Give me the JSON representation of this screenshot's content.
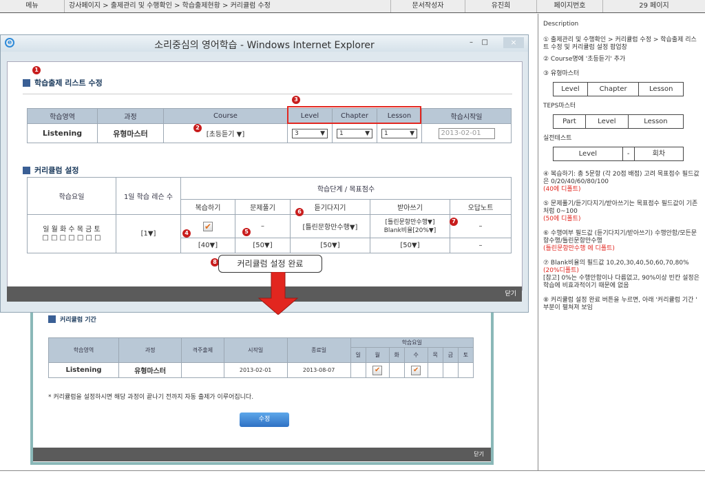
{
  "header": {
    "menu_label": "메뉴",
    "breadcrumb": "강사페이지 > 출제관리 및 수행확인 > 학습출제현황 > 커리큘럼 수정",
    "author_label": "문서작성자",
    "author": "유진희",
    "page_label": "페이지번호",
    "page": "29 페이지"
  },
  "window": {
    "title": "소리중심의 영어학습 - Windows Internet Explorer",
    "minimize": "–",
    "maximize": "□",
    "close": "×",
    "close_bar": "닫기"
  },
  "section1": {
    "title": "학습출제 리스트 수정",
    "headers": [
      "학습영역",
      "과정",
      "Course",
      "Level",
      "Chapter",
      "Lesson",
      "학습시작일"
    ],
    "area": "Listening",
    "course_type": "유형마스터",
    "course": "[초등듣기 ▼]",
    "level": "3",
    "chapter": "1",
    "lesson": "1",
    "start_date": "2013-02-01"
  },
  "section2": {
    "title": "커리큘럼 설정",
    "h_day": "학습요일",
    "h_lessons": "1일 학습 레슨 수",
    "h_stage": "학습단계 / 목표점수",
    "h_cols": [
      "복습하기",
      "문제풀기",
      "듣기다지기",
      "받아쓰기",
      "오답노트"
    ],
    "days": "일 월 화 수 목 금 토",
    "day_boxes": "□ □ □ □ □ □ □",
    "lessons": "[1▼]",
    "dash": "–",
    "listen_mode": "[틀린문항만수행▼]",
    "dictation_mode": "[틀린문항만수행▼]",
    "blank_ratio": "Blank비율[20%▼]",
    "scores": [
      "[40▼]",
      "[50▼]",
      "[50▼]",
      "[50▼]",
      "–"
    ]
  },
  "done_button": "커리큘럼 설정 완료",
  "numbers": [
    "1",
    "2",
    "3",
    "4",
    "5",
    "6",
    "7",
    "8"
  ],
  "behind": {
    "title": "커리큘럼 기간",
    "headers": [
      "학습영역",
      "과정",
      "격주출제",
      "시작일",
      "종료일",
      "학습요일"
    ],
    "days": [
      "일",
      "월",
      "화",
      "수",
      "목",
      "금",
      "토"
    ],
    "row": {
      "area": "Listening",
      "course": "유형마스터",
      "start": "2013-02-01",
      "end": "2013-08-07"
    },
    "notice": "* 커리큘럼을 설정하시면 해당 과정이 끝나기 전까지 자동 출제가 이루어집니다.",
    "edit_button": "수정",
    "close_bar": "닫기"
  },
  "description": {
    "heading": "Description",
    "p1": "① 출제관리 및 수행확인 > 커리큘럼 수정 > 학습출제 리스트 수정 및 커리큘럼 설정 팝업창",
    "p2": "② Course명에 '초등듣기' 추가",
    "p3": "③ 유형마스터",
    "t1": [
      "Level",
      "Chapter",
      "Lesson"
    ],
    "teps": "TEPS마스터",
    "t2": [
      "Part",
      "Level",
      "Lesson"
    ],
    "real": "실전테스트",
    "t3": [
      "Level",
      "-",
      "회차"
    ],
    "p4": "④ 복습하기: 총 5문항 (각 20점 배점) 고려 목표점수 필드값은 0/20/40/60/80/100",
    "p4r": "(40에 디폴트)",
    "p5": "⑤ 문제풀기/듣기다지기/받아쓰기는 목표점수 필드값이 기존처럼 0~100",
    "p5r": "(50에 디폴트)",
    "p6": "⑥ 수행여부 필드값 (듣기다지기/받아쓰기) 수행안함/모든문항수행/틀린문항만수행",
    "p6r": "(틀린문항만수행 에 디폴트)",
    "p7": "⑦ Blank비율의 필드값 10,20,30,40,50,60,70,80%",
    "p7r": "(20%디폴트)",
    "p7b": "[참고] 0%는 수행안함이나 다름없고, 90%이상 빈칸 설정은 학습에 비효과적이기 때문에 없음",
    "p8": "⑧ 커리큘럼 설정 완료 버튼을 누르면, 아래 '커리큘럼 기간 ' 부분이 펼쳐져 보임"
  }
}
